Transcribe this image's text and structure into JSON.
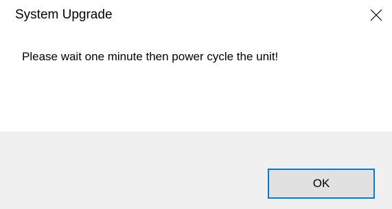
{
  "window": {
    "title": "System Upgrade",
    "close_icon": "close-icon"
  },
  "dialog": {
    "message": "Please wait one minute then power cycle the unit!",
    "ok_label": "OK"
  },
  "colors": {
    "content_background": "#ffffff",
    "footer_background": "#f0f0f0",
    "button_background": "#e1e1e1",
    "button_border": "#adadad",
    "focus_accent": "#0078d7"
  }
}
